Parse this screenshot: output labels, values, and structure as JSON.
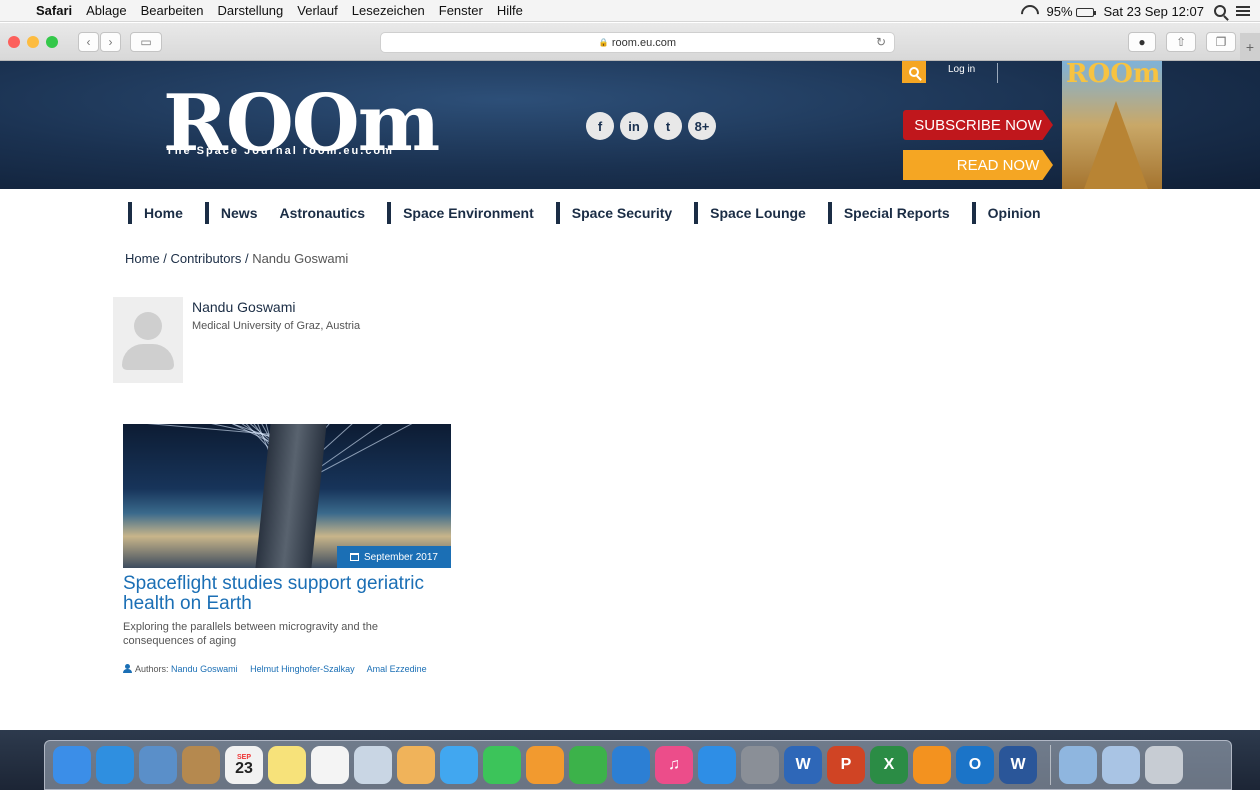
{
  "menubar": {
    "items": [
      "Safari",
      "Ablage",
      "Bearbeiten",
      "Darstellung",
      "Verlauf",
      "Lesezeichen",
      "Fenster",
      "Hilfe"
    ],
    "battery": "95%",
    "datetime": "Sat 23 Sep 12:07"
  },
  "browser": {
    "url": "room.eu.com",
    "url_lock": "🔒",
    "reload_glyph": "↻",
    "plus_glyph": "+"
  },
  "site": {
    "logo": "ROOm",
    "logo_subtitle": "The Space Journal room.eu.com",
    "social": [
      "f",
      "in",
      "t",
      "8+"
    ],
    "login": "Log in",
    "subscribe": "SUBSCRIBE NOW",
    "read": "READ NOW",
    "magazine_title": "ROOm"
  },
  "nav": [
    "Home",
    "News",
    "Astronautics",
    "Space Environment",
    "Space Security",
    "Space Lounge",
    "Special Reports",
    "Opinion"
  ],
  "breadcrumb": {
    "home": "Home",
    "sep": " / ",
    "contributors": "Contributors",
    "current": "Nandu Goswami"
  },
  "profile": {
    "name": "Nandu Goswami",
    "affiliation": "Medical University of Graz, Austria"
  },
  "article": {
    "date": "September 2017",
    "title": "Spaceflight studies support geriatric health on Earth",
    "summary": "Exploring the parallels between microgravity and the consequences of aging",
    "authors_label": "Authors:",
    "authors": [
      "Nandu Goswami",
      "Helmut Hinghofer-Szalkay",
      "Amal Ezzedine"
    ]
  },
  "dock": {
    "calendar_month": "SEP",
    "calendar_day": "23",
    "apps": [
      {
        "name": "finder",
        "color": "#3b8ee8",
        "glyph": ""
      },
      {
        "name": "safari",
        "color": "#2f8fe0",
        "glyph": ""
      },
      {
        "name": "preview",
        "color": "#5a8fc9",
        "glyph": ""
      },
      {
        "name": "contacts",
        "color": "#b5894f",
        "glyph": ""
      },
      {
        "name": "calendar",
        "color": "#f2f2f2",
        "glyph": ""
      },
      {
        "name": "notes",
        "color": "#f7e27a",
        "glyph": ""
      },
      {
        "name": "reminders",
        "color": "#f4f4f4",
        "glyph": ""
      },
      {
        "name": "preview-docs",
        "color": "#c9d6e4",
        "glyph": ""
      },
      {
        "name": "photos",
        "color": "#f0b35a",
        "glyph": ""
      },
      {
        "name": "messages",
        "color": "#41a7f0",
        "glyph": ""
      },
      {
        "name": "facetime",
        "color": "#3cc45a",
        "glyph": ""
      },
      {
        "name": "pages",
        "color": "#f29a2f",
        "glyph": ""
      },
      {
        "name": "numbers",
        "color": "#3cb24a",
        "glyph": ""
      },
      {
        "name": "keynote",
        "color": "#2c7fd4",
        "glyph": ""
      },
      {
        "name": "itunes",
        "color": "#ec4d8a",
        "glyph": "♫"
      },
      {
        "name": "app-store",
        "color": "#2e8ee6",
        "glyph": ""
      },
      {
        "name": "system-preferences",
        "color": "#8a8f97",
        "glyph": ""
      },
      {
        "name": "word-w",
        "color": "#2e67b8",
        "glyph": "W"
      },
      {
        "name": "powerpoint",
        "color": "#d04424",
        "glyph": "P"
      },
      {
        "name": "excel",
        "color": "#2b8c45",
        "glyph": "X"
      },
      {
        "name": "ibooks",
        "color": "#f3921f",
        "glyph": ""
      },
      {
        "name": "outlook",
        "color": "#1b74c8",
        "glyph": "O"
      },
      {
        "name": "word",
        "color": "#2a5699",
        "glyph": "W"
      }
    ],
    "extras": [
      {
        "name": "downloads",
        "color": "#8fb6df"
      },
      {
        "name": "documents",
        "color": "#a9c4e4"
      },
      {
        "name": "trash",
        "color": "#c7ccd3"
      }
    ]
  }
}
